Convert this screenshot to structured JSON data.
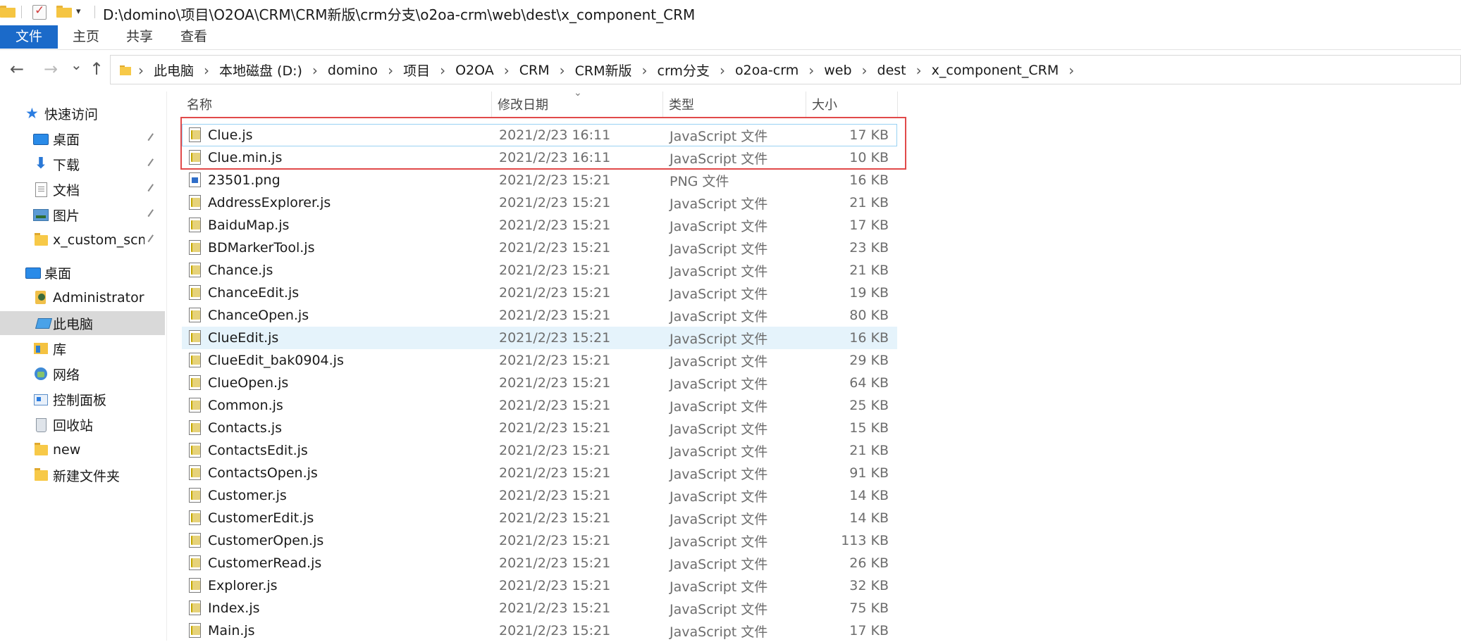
{
  "window": {
    "title": "D:\\domino\\项目\\O2OA\\CRM\\CRM新版\\crm分支\\o2oa-crm\\web\\dest\\x_component_CRM",
    "quick_access_dropdown": "▾"
  },
  "ribbon": {
    "tabs": [
      {
        "label": "文件",
        "active": true
      },
      {
        "label": "主页"
      },
      {
        "label": "共享"
      },
      {
        "label": "查看"
      }
    ],
    "accent": "#1b6ac9"
  },
  "nav": {
    "back": "←",
    "forward": "→",
    "recent": "⌄",
    "up": "↑"
  },
  "breadcrumb": {
    "segments": [
      "此电脑",
      "本地磁盘 (D:)",
      "domino",
      "项目",
      "O2OA",
      "CRM",
      "CRM新版",
      "crm分支",
      "o2oa-crm",
      "web",
      "dest",
      "x_component_CRM"
    ],
    "separator": "›"
  },
  "sidebar": {
    "items": [
      {
        "label": "快速访问",
        "icon": "star-icon"
      },
      {
        "label": "桌面",
        "icon": "desktop-icon",
        "pinned": true
      },
      {
        "label": "下载",
        "icon": "download-icon",
        "pinned": true
      },
      {
        "label": "文档",
        "icon": "document-icon",
        "pinned": true
      },
      {
        "label": "图片",
        "icon": "pictures-icon",
        "pinned": true
      },
      {
        "label": "x_custom_scm_d",
        "icon": "folder-icon",
        "pinned": true
      },
      {
        "label": "桌面",
        "icon": "desktop-icon"
      },
      {
        "label": "Administrator",
        "icon": "user-icon"
      },
      {
        "label": "此电脑",
        "icon": "computer-icon",
        "selected": true
      },
      {
        "label": "库",
        "icon": "library-icon"
      },
      {
        "label": "网络",
        "icon": "network-icon"
      },
      {
        "label": "控制面板",
        "icon": "control-panel-icon"
      },
      {
        "label": "回收站",
        "icon": "recycle-bin-icon"
      },
      {
        "label": "new",
        "icon": "folder-icon"
      },
      {
        "label": "新建文件夹",
        "icon": "folder-icon"
      }
    ],
    "pin_glyph": "📌"
  },
  "file_list": {
    "columns": {
      "name": "名称",
      "date": "修改日期",
      "type": "类型",
      "size": "大小"
    },
    "sort_indicator": "⌄",
    "rows": [
      {
        "name": "Clue.js",
        "date": "2021/2/23 16:11",
        "type": "JavaScript 文件",
        "size": "17 KB",
        "icon": "js-file-icon"
      },
      {
        "name": "Clue.min.js",
        "date": "2021/2/23 16:11",
        "type": "JavaScript 文件",
        "size": "10 KB",
        "icon": "js-file-icon"
      },
      {
        "name": "23501.png",
        "date": "2021/2/23 15:21",
        "type": "PNG 文件",
        "size": "16 KB",
        "icon": "png-file-icon"
      },
      {
        "name": "AddressExplorer.js",
        "date": "2021/2/23 15:21",
        "type": "JavaScript 文件",
        "size": "21 KB",
        "icon": "js-file-icon"
      },
      {
        "name": "BaiduMap.js",
        "date": "2021/2/23 15:21",
        "type": "JavaScript 文件",
        "size": "17 KB",
        "icon": "js-file-icon"
      },
      {
        "name": "BDMarkerTool.js",
        "date": "2021/2/23 15:21",
        "type": "JavaScript 文件",
        "size": "23 KB",
        "icon": "js-file-icon"
      },
      {
        "name": "Chance.js",
        "date": "2021/2/23 15:21",
        "type": "JavaScript 文件",
        "size": "21 KB",
        "icon": "js-file-icon"
      },
      {
        "name": "ChanceEdit.js",
        "date": "2021/2/23 15:21",
        "type": "JavaScript 文件",
        "size": "19 KB",
        "icon": "js-file-icon"
      },
      {
        "name": "ChanceOpen.js",
        "date": "2021/2/23 15:21",
        "type": "JavaScript 文件",
        "size": "80 KB",
        "icon": "js-file-icon"
      },
      {
        "name": "ClueEdit.js",
        "date": "2021/2/23 15:21",
        "type": "JavaScript 文件",
        "size": "16 KB",
        "icon": "js-file-icon"
      },
      {
        "name": "ClueEdit_bak0904.js",
        "date": "2021/2/23 15:21",
        "type": "JavaScript 文件",
        "size": "29 KB",
        "icon": "js-file-icon"
      },
      {
        "name": "ClueOpen.js",
        "date": "2021/2/23 15:21",
        "type": "JavaScript 文件",
        "size": "64 KB",
        "icon": "js-file-icon"
      },
      {
        "name": "Common.js",
        "date": "2021/2/23 15:21",
        "type": "JavaScript 文件",
        "size": "25 KB",
        "icon": "js-file-icon"
      },
      {
        "name": "Contacts.js",
        "date": "2021/2/23 15:21",
        "type": "JavaScript 文件",
        "size": "15 KB",
        "icon": "js-file-icon"
      },
      {
        "name": "ContactsEdit.js",
        "date": "2021/2/23 15:21",
        "type": "JavaScript 文件",
        "size": "21 KB",
        "icon": "js-file-icon"
      },
      {
        "name": "ContactsOpen.js",
        "date": "2021/2/23 15:21",
        "type": "JavaScript 文件",
        "size": "91 KB",
        "icon": "js-file-icon"
      },
      {
        "name": "Customer.js",
        "date": "2021/2/23 15:21",
        "type": "JavaScript 文件",
        "size": "14 KB",
        "icon": "js-file-icon"
      },
      {
        "name": "CustomerEdit.js",
        "date": "2021/2/23 15:21",
        "type": "JavaScript 文件",
        "size": "14 KB",
        "icon": "js-file-icon"
      },
      {
        "name": "CustomerOpen.js",
        "date": "2021/2/23 15:21",
        "type": "JavaScript 文件",
        "size": "113 KB",
        "icon": "js-file-icon"
      },
      {
        "name": "CustomerRead.js",
        "date": "2021/2/23 15:21",
        "type": "JavaScript 文件",
        "size": "26 KB",
        "icon": "js-file-icon"
      },
      {
        "name": "Explorer.js",
        "date": "2021/2/23 15:21",
        "type": "JavaScript 文件",
        "size": "32 KB",
        "icon": "js-file-icon"
      },
      {
        "name": "Index.js",
        "date": "2021/2/23 15:21",
        "type": "JavaScript 文件",
        "size": "75 KB",
        "icon": "js-file-icon"
      },
      {
        "name": "Main.js",
        "date": "2021/2/23 15:21",
        "type": "JavaScript 文件",
        "size": "17 KB",
        "icon": "js-file-icon"
      }
    ],
    "hovered_row": "ClueEdit.js",
    "focused_row": "Clue.js",
    "annotation_color": "#e14a4a"
  }
}
